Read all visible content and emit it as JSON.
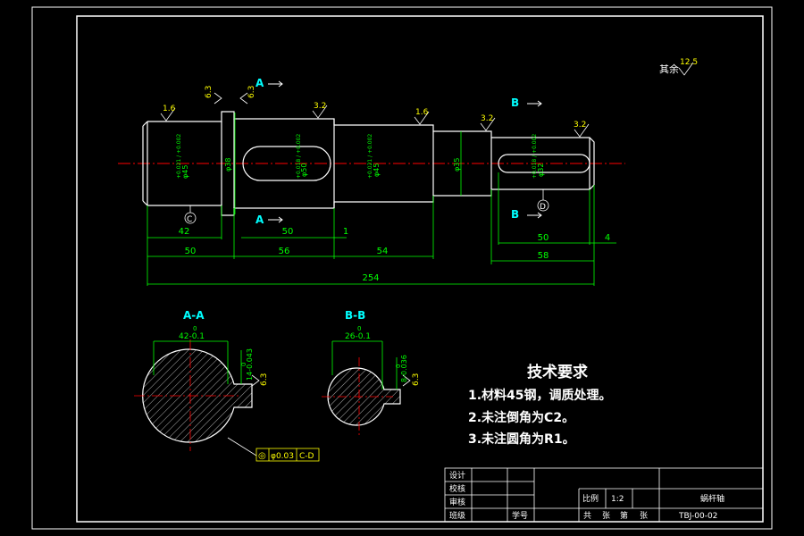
{
  "labels": {
    "section_a": "A",
    "section_b": "B",
    "section_aa": "A-A",
    "section_bb": "B-B",
    "other_roughness": "其余",
    "datum_c": "C",
    "datum_d": "D"
  },
  "roughness": [
    "6.3",
    "6.3",
    "1.6",
    "3.2",
    "1.6",
    "3.2",
    "3.2",
    "12.5",
    "6.3",
    "6.3"
  ],
  "diameters": {
    "d1": "φ45",
    "d1_tol": "+0.021 / +0.002",
    "d2": "φ38",
    "d3": "φ50",
    "d3_tol": "+0.018 / +0.002",
    "d4": "φ45",
    "d4_tol": "+0.021 / +0.002",
    "d5": "φ35",
    "d6": "φ32",
    "d6_tol": "+0.018 / +0.002"
  },
  "dims": {
    "key1": "42",
    "key2": "50",
    "len1": "50",
    "len2": "56",
    "len3": "54",
    "len4": "58",
    "len5": "4",
    "len6": "1",
    "total": "254",
    "keyslot_b": "50"
  },
  "sections": {
    "aa_width": "42-0.1",
    "aa_width_tol": "0",
    "aa_key": "14-0.043",
    "aa_key_tol": "0",
    "bb_width": "26-0.1",
    "bb_width_tol": "0",
    "bb_key": "8-0.036",
    "bb_key_tol": "0",
    "fcf_value": "0.03",
    "fcf_datum": "C-D",
    "fcf_symbol": "◎"
  },
  "tech_req": {
    "title": "技术要求",
    "items": [
      "1.材料45钢，调质处理。",
      "2.未注倒角为C2。",
      "3.未注圆角为R1。"
    ]
  },
  "title_block": {
    "design": "设计",
    "check": "校核",
    "review": "审核",
    "class": "班级",
    "student_no": "学号",
    "scale_label": "比例",
    "scale_value": "1:2",
    "part_name": "蜗杆轴",
    "sheets_total": "共",
    "sheet_unit1": "张",
    "sheet_no": "第",
    "sheet_unit2": "张",
    "drawing_no": "TBJ-00-02"
  }
}
